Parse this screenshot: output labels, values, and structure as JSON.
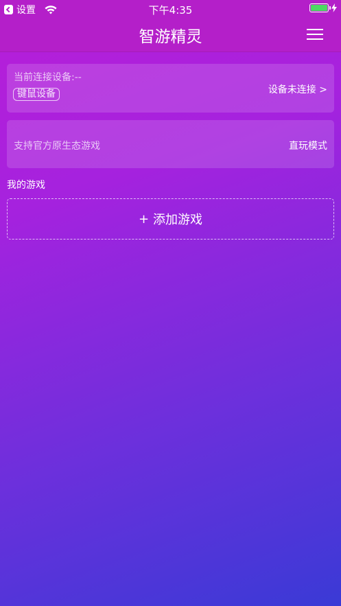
{
  "status_bar": {
    "back_app": "设置",
    "time": "下午4:35"
  },
  "nav": {
    "title": "智游精灵",
    "menu_icon": "hamburger-icon"
  },
  "device_card": {
    "label": "当前连接设备:--",
    "tag": "键鼠设备",
    "action": "设备未连接 >"
  },
  "mode_card": {
    "label": "支持官方原生态游戏",
    "action": "直玩模式"
  },
  "my_games": {
    "title": "我的游戏",
    "add_plus": "+",
    "add_label": "添加游戏"
  },
  "colors": {
    "header": "#b41fc9",
    "gradient_start": "#b81ed8",
    "gradient_end": "#3a3ad6",
    "battery": "#4cd964"
  }
}
